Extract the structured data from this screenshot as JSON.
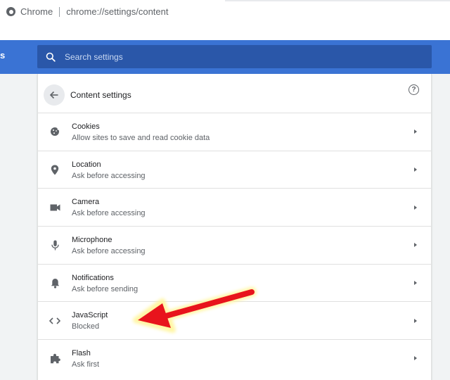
{
  "browser": {
    "tab_label": "Chrome",
    "url": "chrome://settings/content"
  },
  "toolbar": {
    "heading_clip": "s",
    "search_placeholder": "Search settings"
  },
  "content": {
    "title": "Content settings",
    "rows": [
      {
        "title": "Cookies",
        "subtitle": "Allow sites to save and read cookie data",
        "icon": "cookie-icon"
      },
      {
        "title": "Location",
        "subtitle": "Ask before accessing",
        "icon": "location-pin-icon"
      },
      {
        "title": "Camera",
        "subtitle": "Ask before accessing",
        "icon": "camera-icon"
      },
      {
        "title": "Microphone",
        "subtitle": "Ask before accessing",
        "icon": "microphone-icon"
      },
      {
        "title": "Notifications",
        "subtitle": "Ask before sending",
        "icon": "bell-icon"
      },
      {
        "title": "JavaScript",
        "subtitle": "Blocked",
        "icon": "code-icon"
      },
      {
        "title": "Flash",
        "subtitle": "Ask first",
        "icon": "puzzle-icon"
      }
    ]
  },
  "colors": {
    "toolbar_blue": "#3a73d4",
    "search_bg": "#2a57a9",
    "annotation_arrow": "#e8141c",
    "annotation_glow": "#fff59a"
  }
}
